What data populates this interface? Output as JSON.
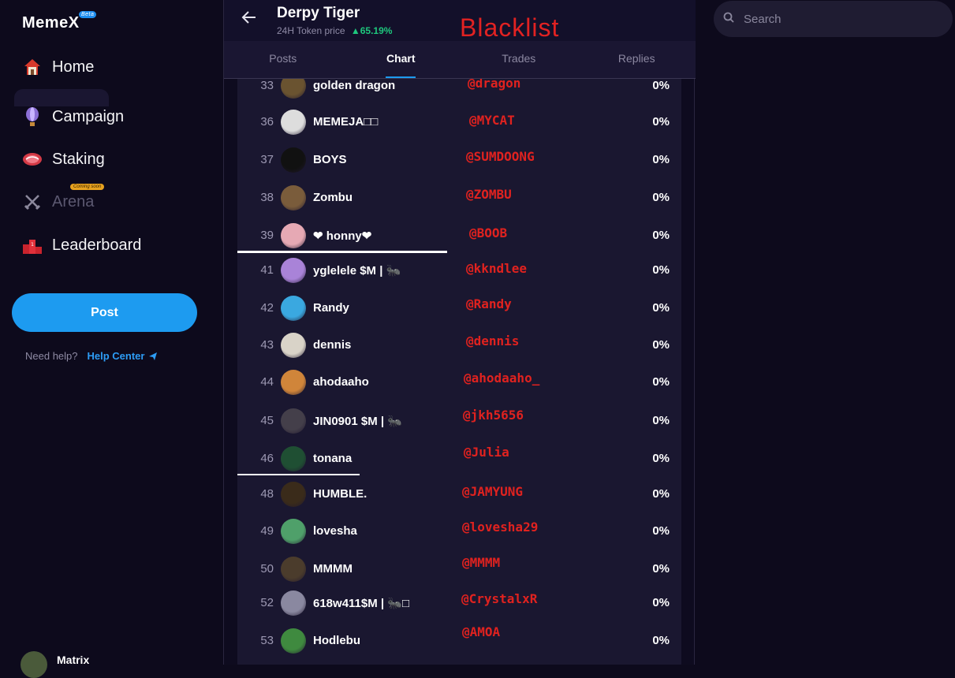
{
  "app": {
    "logo": "MemeX",
    "beta": "Beta"
  },
  "sidebar": {
    "items": [
      {
        "label": "Home",
        "icon": "house-icon"
      },
      {
        "label": "Campaign",
        "icon": "balloon-icon"
      },
      {
        "label": "Staking",
        "icon": "meat-icon"
      },
      {
        "label": "Arena",
        "icon": "swords-icon",
        "badge": "Coming soon",
        "disabled": true
      },
      {
        "label": "Leaderboard",
        "icon": "podium-icon"
      }
    ],
    "post_label": "Post",
    "help_text": "Need help?",
    "help_link": "Help Center",
    "profile_name": "Matrix"
  },
  "header": {
    "token_name": "Derpy Tiger",
    "subtitle": "24H Token price",
    "change": "▲65.19%",
    "change_color": "#1ec77d",
    "overlay_title": "Blacklist"
  },
  "tabs": [
    {
      "label": "Posts",
      "active": false
    },
    {
      "label": "Chart",
      "active": true
    },
    {
      "label": "Trades",
      "active": false
    },
    {
      "label": "Replies",
      "active": false
    }
  ],
  "holders": [
    {
      "rank": "33",
      "name": "golden dragon",
      "handle": "@dragon",
      "pct": "0%"
    },
    {
      "rank": "36",
      "name": "MEMEJA□□",
      "handle": "@MYCAT",
      "pct": "0%"
    },
    {
      "rank": "37",
      "name": "BOYS",
      "handle": "@SUMDOONG",
      "pct": "0%"
    },
    {
      "rank": "38",
      "name": "Zombu",
      "handle": "@ZOMBU",
      "pct": "0%"
    },
    {
      "rank": "39",
      "name": "❤ honny❤",
      "handle": "@BOOB",
      "pct": "0%"
    },
    {
      "rank": "41",
      "name": "yglelele $M | 🐜",
      "handle": "@kkndlee",
      "pct": "0%"
    },
    {
      "rank": "42",
      "name": "Randy",
      "handle": "@Randy",
      "pct": "0%"
    },
    {
      "rank": "43",
      "name": "dennis",
      "handle": "@dennis",
      "pct": "0%"
    },
    {
      "rank": "44",
      "name": "ahodaaho",
      "handle": "@ahodaaho_",
      "pct": "0%"
    },
    {
      "rank": "45",
      "name": "JIN0901 $M | 🐜",
      "handle": "@jkh5656",
      "pct": "0%"
    },
    {
      "rank": "46",
      "name": "tonana",
      "handle": "@Julia",
      "pct": "0%"
    },
    {
      "rank": "48",
      "name": "HUMBLE.",
      "handle": "@JAMYUNG",
      "pct": "0%"
    },
    {
      "rank": "49",
      "name": "lovesha",
      "handle": "@lovesha29",
      "pct": "0%"
    },
    {
      "rank": "50",
      "name": "MMMM",
      "handle": "@MMMM",
      "pct": "0%"
    },
    {
      "rank": "52",
      "name": "618w411$M | 🐜□",
      "handle": "@CrystalxR",
      "pct": "0%"
    },
    {
      "rank": "53",
      "name": "Hodlebu",
      "handle": "@AMOA",
      "pct": "0%"
    }
  ],
  "search": {
    "placeholder": "Search"
  }
}
